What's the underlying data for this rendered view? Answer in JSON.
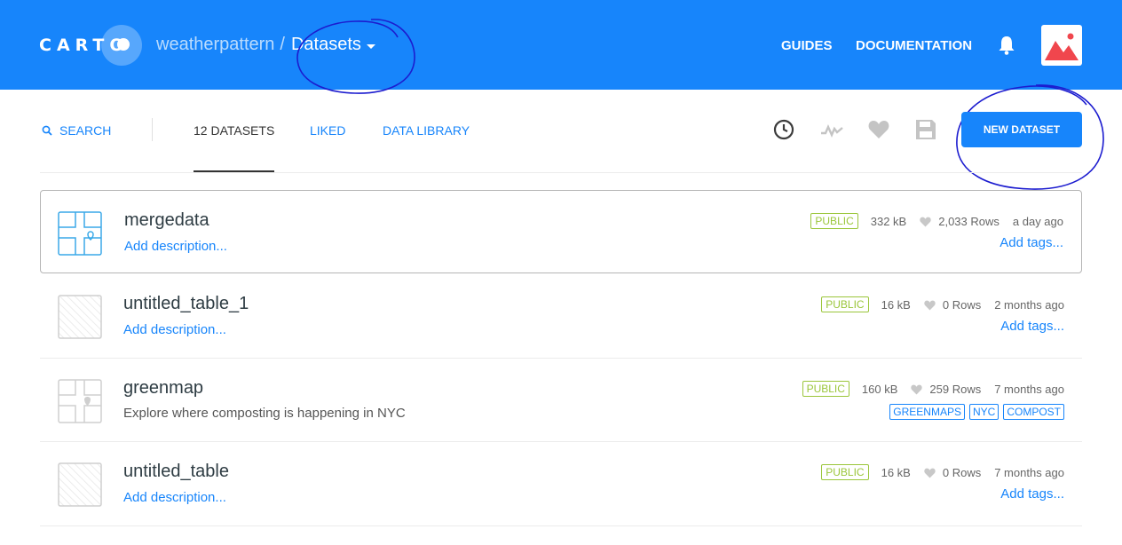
{
  "header": {
    "logo": "CARTO",
    "account": "weatherpattern",
    "separator": "/",
    "section": "Datasets",
    "nav": [
      "GUIDES",
      "DOCUMENTATION"
    ]
  },
  "toolbar": {
    "search": "SEARCH",
    "tabs": [
      "12 DATASETS",
      "LIKED",
      "DATA LIBRARY"
    ],
    "new_button": "NEW DATASET"
  },
  "datasets": [
    {
      "name": "mergedata",
      "description": "Add description...",
      "privacy": "PUBLIC",
      "size": "332 kB",
      "rows": "2,033 Rows",
      "updated": "a day ago",
      "tags_link": "Add tags..."
    },
    {
      "name": "untitled_table_1",
      "description": "Add description...",
      "privacy": "PUBLIC",
      "size": "16 kB",
      "rows": "0 Rows",
      "updated": "2 months ago",
      "tags_link": "Add tags..."
    },
    {
      "name": "greenmap",
      "description": "Explore where composting is happening in NYC",
      "privacy": "PUBLIC",
      "size": "160 kB",
      "rows": "259 Rows",
      "updated": "7 months ago",
      "tags": [
        "GREENMAPS",
        "NYC",
        "COMPOST"
      ]
    },
    {
      "name": "untitled_table",
      "description": "Add description...",
      "privacy": "PUBLIC",
      "size": "16 kB",
      "rows": "0 Rows",
      "updated": "7 months ago",
      "tags_link": "Add tags..."
    }
  ],
  "colors": {
    "brand_blue": "#1785fb",
    "public_green": "#9bc63b",
    "annotation": "#1c1ccf"
  },
  "icons": {
    "search": "search-icon",
    "bell": "bell-icon",
    "recent": "clock-icon",
    "activity": "pulse-icon",
    "liked": "heart-icon",
    "shared": "save-icon",
    "map_thumbnail": "map-pin-icon",
    "empty_thumbnail": "empty-table-icon"
  }
}
